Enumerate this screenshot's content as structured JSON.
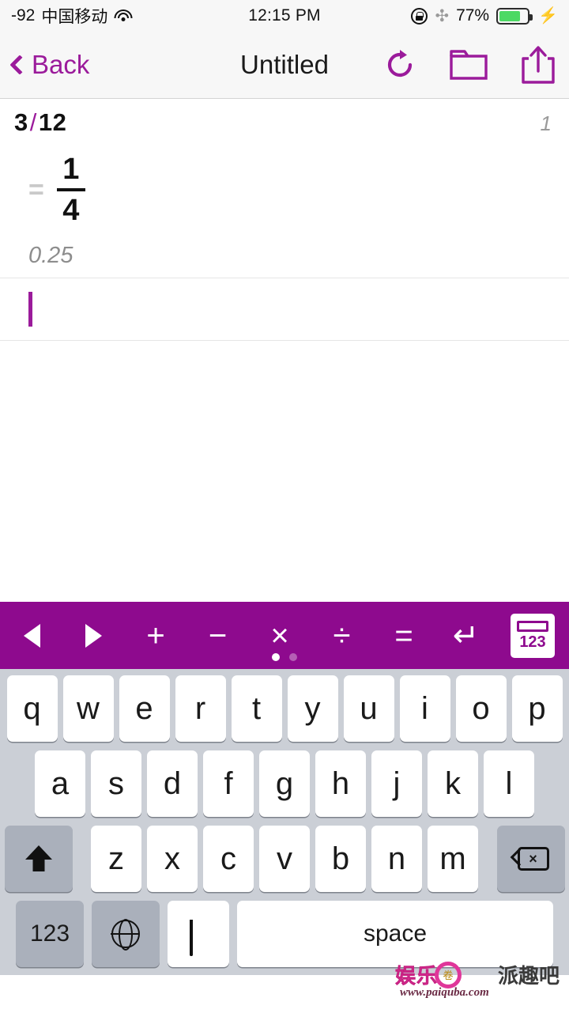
{
  "status_bar": {
    "signal_text": "-92",
    "carrier": "中国移动",
    "wifi_icon": "wifi-icon",
    "time": "12:15 PM",
    "rotation_lock_icon": "rotation-lock-icon",
    "bluetooth_icon": "bluetooth-icon",
    "battery_percent": "77%",
    "battery_level": 77,
    "charging_icon": "lightning-bolt-icon"
  },
  "nav_bar": {
    "back_label": "Back",
    "back_icon": "chevron-left-icon",
    "title": "Untitled",
    "actions": [
      {
        "name": "redo-icon",
        "glyph": "↻"
      },
      {
        "name": "folder-icon",
        "glyph": "▢"
      },
      {
        "name": "share-icon",
        "glyph": "↑"
      }
    ]
  },
  "editor": {
    "lines": [
      {
        "line_number": "1",
        "expression_left": "3",
        "expression_operator": "/",
        "expression_right": "12",
        "equals_sign": "=",
        "result_numerator": "1",
        "result_denominator": "4",
        "decimal_value": "0.25"
      }
    ],
    "cursor_line_empty": true
  },
  "math_toolbar": {
    "background_color": "#8E0A8E",
    "buttons": [
      {
        "name": "cursor-left-button",
        "label": "◀"
      },
      {
        "name": "cursor-right-button",
        "label": "▶"
      },
      {
        "name": "plus-button",
        "label": "+"
      },
      {
        "name": "minus-button",
        "label": "−"
      },
      {
        "name": "multiply-button",
        "label": "×"
      },
      {
        "name": "divide-button",
        "label": "÷"
      },
      {
        "name": "equals-button",
        "label": "="
      },
      {
        "name": "return-button",
        "label": "↵"
      }
    ],
    "numpad_label": "123",
    "page_dots": {
      "count": 2,
      "active_index": 0
    }
  },
  "keyboard": {
    "row_1": [
      "q",
      "w",
      "e",
      "r",
      "t",
      "y",
      "u",
      "i",
      "o",
      "p"
    ],
    "row_2": [
      "a",
      "s",
      "d",
      "f",
      "g",
      "h",
      "j",
      "k",
      "l"
    ],
    "row_3": [
      "z",
      "x",
      "c",
      "v",
      "b",
      "n",
      "m"
    ],
    "shift_icon": "shift-arrow-icon",
    "backspace_icon": "backspace-icon",
    "numeric_key_label": "123",
    "globe_icon": "globe-icon",
    "mic_icon": "microphone-icon",
    "space_label": "space"
  },
  "watermark": {
    "logo_text": "娱乐",
    "brand_text": "派趣吧",
    "site_text": "www.paiquba.com"
  },
  "colors": {
    "accent_purple": "#9B1B9B",
    "toolbar_purple": "#8E0A8E",
    "battery_green": "#4cd964",
    "keyboard_bg": "#cbcfd6",
    "watermark_pink": "#e0369a"
  }
}
